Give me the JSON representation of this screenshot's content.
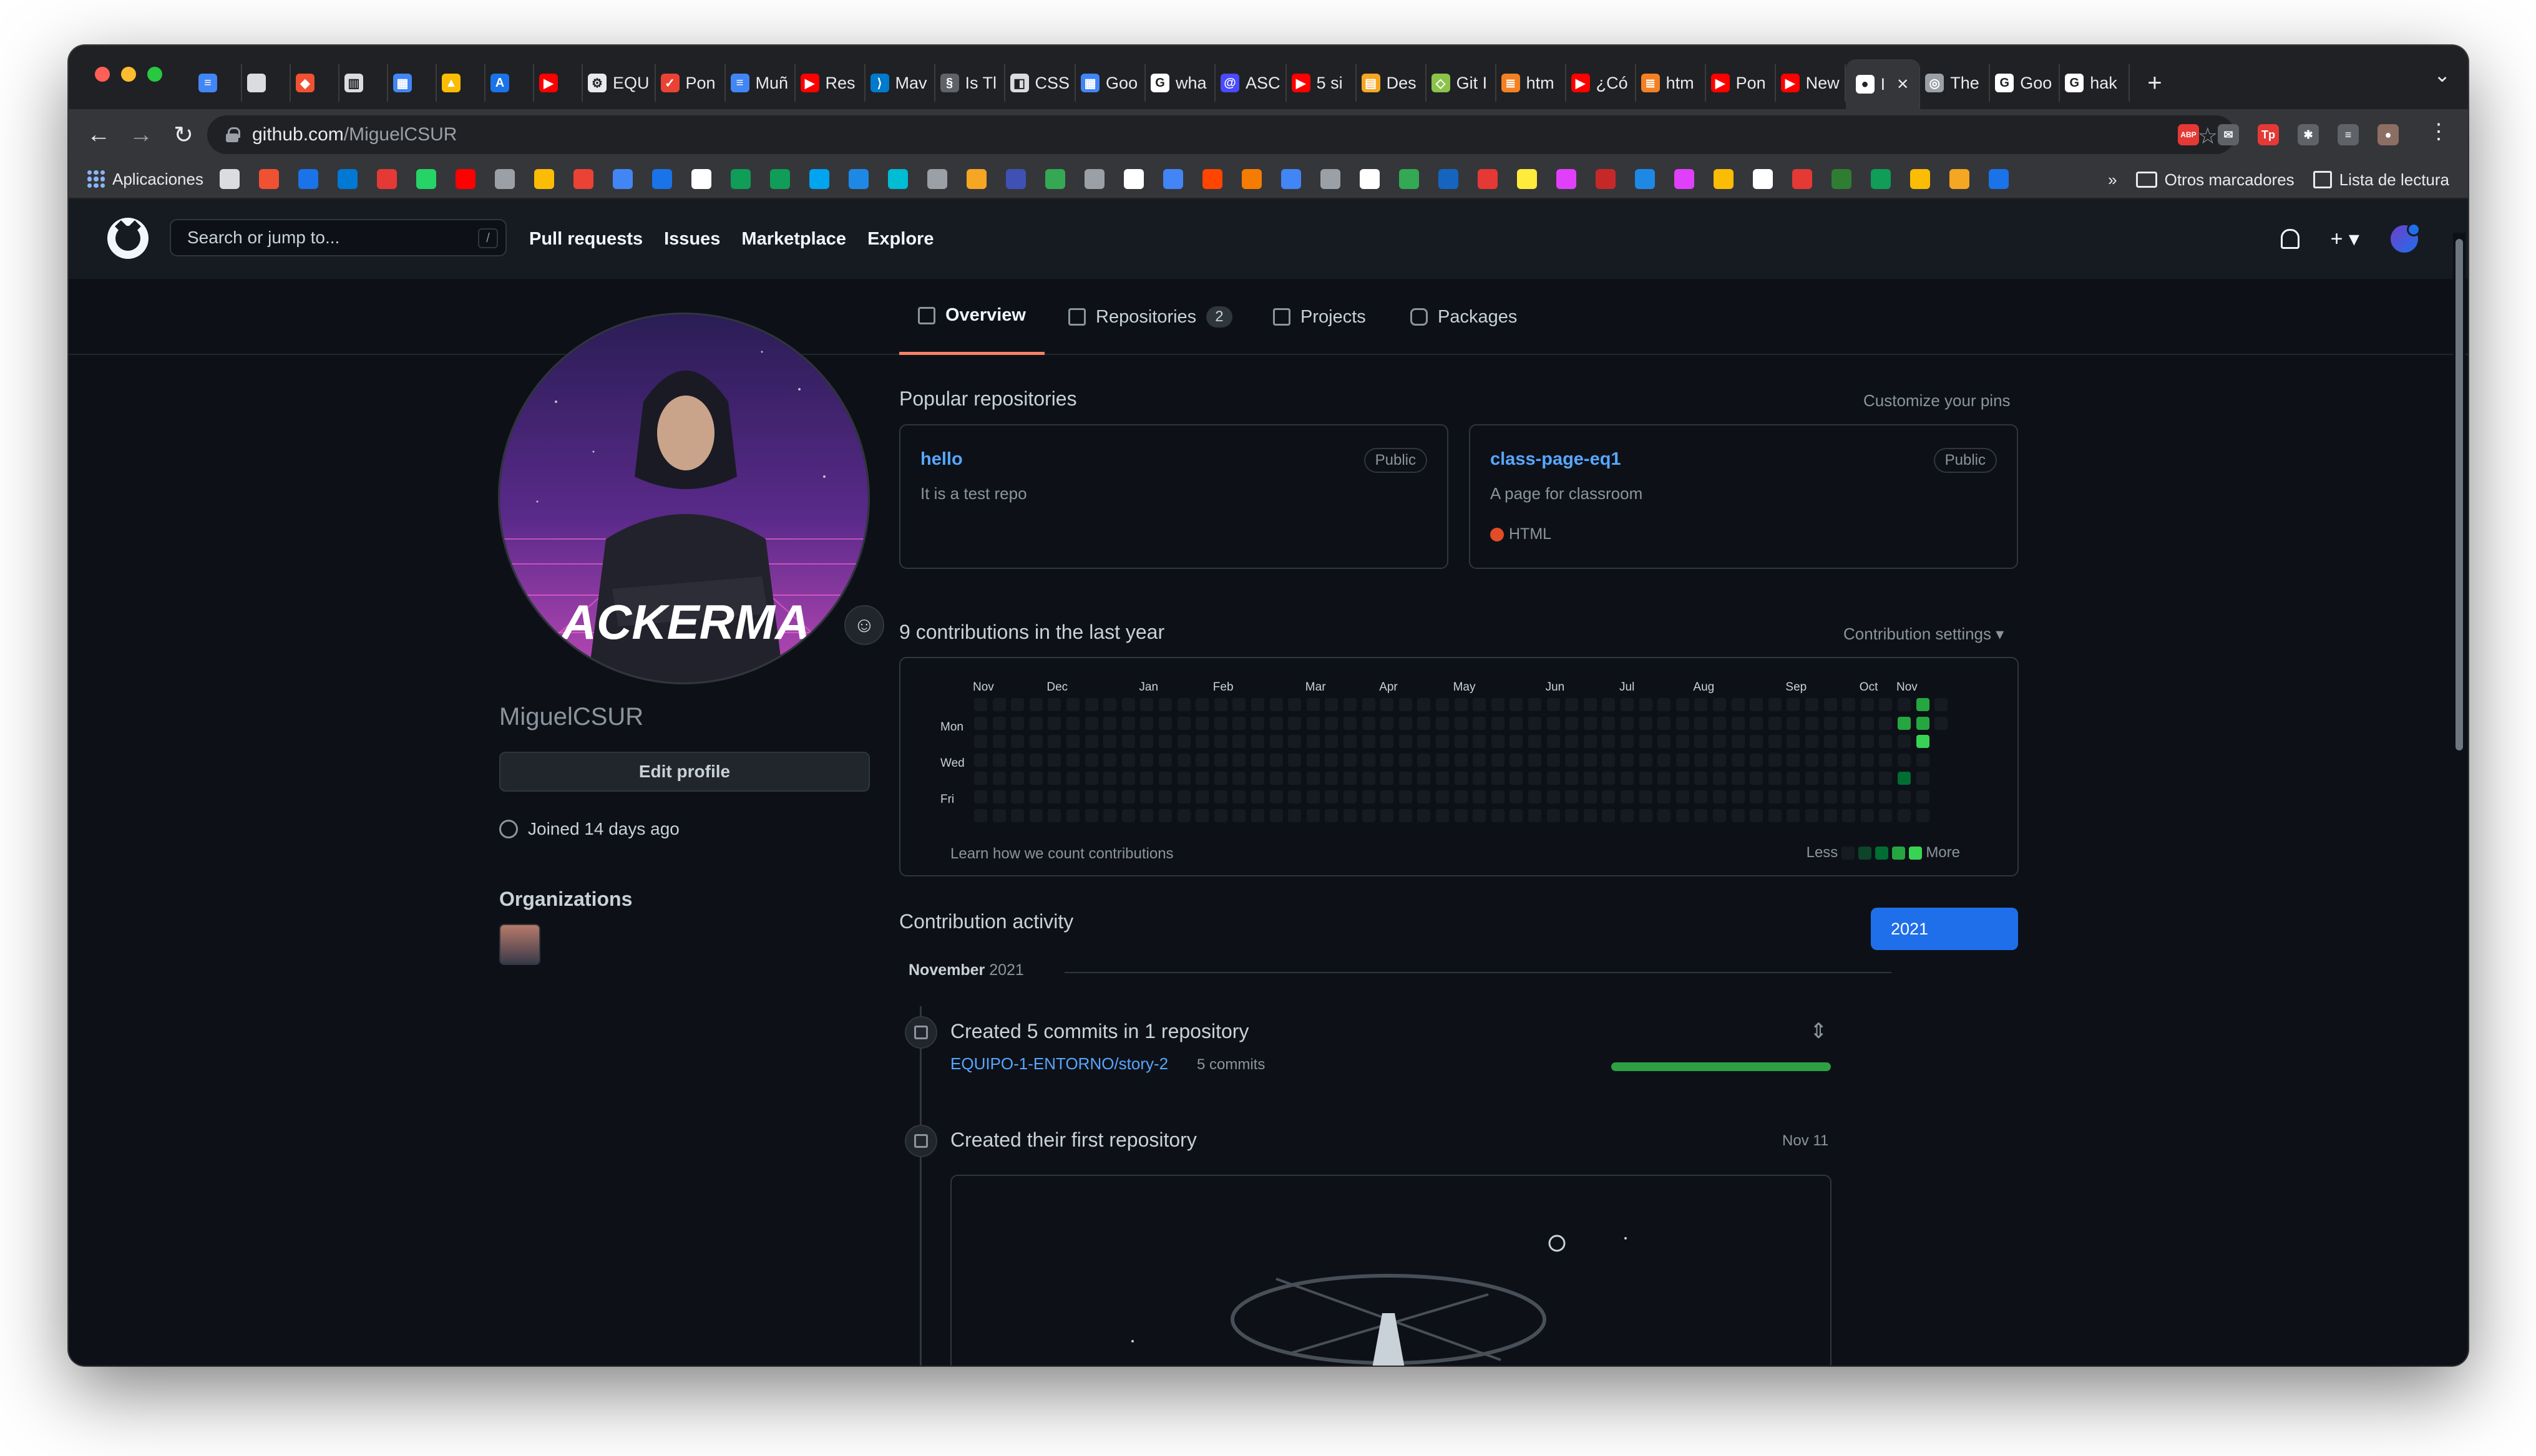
{
  "browser": {
    "tabs": [
      {
        "label": "",
        "color": "#4285f4",
        "glyph": "≡"
      },
      {
        "label": "",
        "color": "#dadce0",
        "glyph": ""
      },
      {
        "label": "",
        "color": "#f05133",
        "glyph": "◆"
      },
      {
        "label": "",
        "color": "#dadce0",
        "glyph": "▥"
      },
      {
        "label": "",
        "color": "#4285f4",
        "glyph": "▦"
      },
      {
        "label": "",
        "color": "#fbbc04",
        "glyph": "▲"
      },
      {
        "label": "",
        "color": "#1a73e8",
        "glyph": "A"
      },
      {
        "label": "",
        "color": "#ff0000",
        "glyph": "▶"
      },
      {
        "label": "EQU",
        "color": "#e8eaed",
        "glyph": "⚙"
      },
      {
        "label": "Pon",
        "color": "#ea4335",
        "glyph": "✓"
      },
      {
        "label": "Muñ",
        "color": "#4285f4",
        "glyph": "≡"
      },
      {
        "label": "Res",
        "color": "#ff0000",
        "glyph": "▶"
      },
      {
        "label": "Mav",
        "color": "#007acc",
        "glyph": "⟩"
      },
      {
        "label": "Is Tl",
        "color": "#5f6368",
        "glyph": "§"
      },
      {
        "label": "CSS",
        "color": "#dadce0",
        "glyph": "◧"
      },
      {
        "label": "Goo",
        "color": "#4285f4",
        "glyph": "▦"
      },
      {
        "label": "wha",
        "color": "#ffffff",
        "glyph": "G"
      },
      {
        "label": "ASC",
        "color": "#4a4aff",
        "glyph": "@"
      },
      {
        "label": "5 si",
        "color": "#ff0000",
        "glyph": "▶"
      },
      {
        "label": "Des",
        "color": "#f5a623",
        "glyph": "▤"
      },
      {
        "label": "Git I",
        "color": "#8bc34a",
        "glyph": "◇"
      },
      {
        "label": "htm",
        "color": "#f48024",
        "glyph": "≣"
      },
      {
        "label": "¿Có",
        "color": "#ff0000",
        "glyph": "▶"
      },
      {
        "label": "htm",
        "color": "#f48024",
        "glyph": "≣"
      },
      {
        "label": "Pon",
        "color": "#ff0000",
        "glyph": "▶"
      },
      {
        "label": "New",
        "color": "#ff0000",
        "glyph": "▶"
      },
      {
        "label": "I",
        "color": "#ffffff",
        "glyph": "●",
        "active": true
      },
      {
        "label": "The",
        "color": "#9aa0a6",
        "glyph": "◎"
      },
      {
        "label": "Goo",
        "color": "#ffffff",
        "glyph": "G"
      },
      {
        "label": "hak",
        "color": "#ffffff",
        "glyph": "G"
      }
    ],
    "new_tab": "+",
    "tab_close": "✕",
    "address": {
      "host": "github.com",
      "path": "/MiguelCSUR"
    },
    "nav": {
      "back": "←",
      "forward": "→",
      "reload": "↻",
      "star": "☆",
      "menu": "⋮"
    },
    "extensions": [
      {
        "color": "#e53935",
        "glyph": "ABP"
      },
      {
        "color": "#5f6368",
        "glyph": "✉"
      },
      {
        "color": "#e53935",
        "glyph": "Tp"
      },
      {
        "color": "#5f6368",
        "glyph": "✱"
      },
      {
        "color": "#5f6368",
        "glyph": "≡"
      },
      {
        "color": "#8d6e63",
        "glyph": "●"
      }
    ],
    "bookmarks": {
      "apps_label": "Aplicaciones",
      "icon_colors": [
        "#dadce0",
        "#f05133",
        "#1a73e8",
        "#0078d4",
        "#e53935",
        "#25d366",
        "#ff0000",
        "#9aa0a6",
        "#fbbc04",
        "#ea4335",
        "#4285f4",
        "#1a73e8",
        "#ffffff",
        "#0f9d58",
        "#0f9d58",
        "#00a4ef",
        "#1e88e5",
        "#00bcd4",
        "#9aa0a6",
        "#f5a623",
        "#3f51b5",
        "#34a853",
        "#9aa0a6",
        "#ffffff",
        "#4285f4",
        "#ff4500",
        "#f57c00",
        "#4285f4",
        "#9aa0a6",
        "#ffffff",
        "#34a853",
        "#1565c0",
        "#e53935",
        "#ffeb3b",
        "#e040fb",
        "#c62828",
        "#1e88e5",
        "#e040fb",
        "#fbbc04",
        "#ffffff",
        "#e53935",
        "#2e7d32",
        "#0f9d58",
        "#fbbc04",
        "#f5a623",
        "#1a73e8"
      ],
      "overflow": "»",
      "other_label": "Otros marcadores",
      "reading_label": "Lista de lectura"
    }
  },
  "github": {
    "search_placeholder": "Search or jump to...",
    "search_key": "/",
    "nav": [
      "Pull requests",
      "Issues",
      "Marketplace",
      "Explore"
    ],
    "plus": "+ ▾",
    "profile_tabs": {
      "overview": "Overview",
      "repositories": "Repositories",
      "repositories_count": "2",
      "projects": "Projects",
      "packages": "Packages"
    },
    "profile": {
      "username": "MiguelCSUR",
      "avatar_text": "ACKERMA",
      "edit_label": "Edit profile",
      "joined": "Joined 14 days ago",
      "orgs_title": "Organizations",
      "smiley": "☺"
    },
    "popular": {
      "title": "Popular repositories",
      "customize": "Customize your pins",
      "repos": [
        {
          "name": "hello",
          "visibility": "Public",
          "description": "It is a test repo",
          "language": ""
        },
        {
          "name": "class-page-eq1",
          "visibility": "Public",
          "description": "A page for classroom",
          "language": "HTML",
          "language_color": "#e34c26"
        }
      ]
    },
    "contributions": {
      "title": "9 contributions in the last year",
      "settings": "Contribution settings ▾",
      "months": [
        "Nov",
        "Dec",
        "Jan",
        "Feb",
        "Mar",
        "Apr",
        "May",
        "Jun",
        "Jul",
        "Aug",
        "Sep",
        "Oct",
        "Nov"
      ],
      "days": [
        "Mon",
        "Wed",
        "Fri"
      ],
      "learn": "Learn how we count contributions",
      "less": "Less",
      "more": "More",
      "weeks": 53,
      "active_cells": [
        {
          "week": 51,
          "day": 0,
          "level": 3
        },
        {
          "week": 50,
          "day": 1,
          "level": 3
        },
        {
          "week": 51,
          "day": 1,
          "level": 3
        },
        {
          "week": 51,
          "day": 2,
          "level": 4
        },
        {
          "week": 50,
          "day": 4,
          "level": 2
        }
      ],
      "level_colors": [
        "#161b22",
        "#0e4429",
        "#006d32",
        "#26a641",
        "#39d353"
      ]
    },
    "activity": {
      "title": "Contribution activity",
      "year": "2021",
      "month": "November",
      "month_year": "2021",
      "commits_title": "Created 5 commits in 1 repository",
      "commit_repo": "EQUIPO-1-ENTORNO/story-2",
      "commit_count": "5 commits",
      "commit_progress": 1.0,
      "first_repo_title": "Created their first repository",
      "first_repo_date": "Nov 11",
      "expand": "⇕"
    }
  }
}
